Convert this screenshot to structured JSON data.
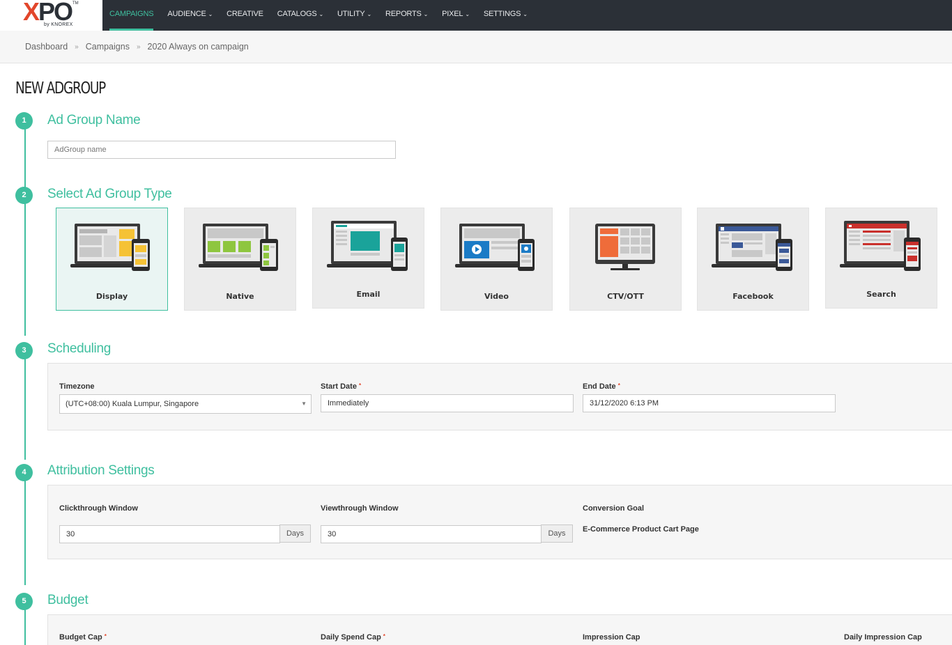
{
  "logo": {
    "mark_x": "X",
    "mark_rest": "PO",
    "tm": "TM",
    "sub": "by KNOREX"
  },
  "nav": [
    {
      "label": "CAMPAIGNS",
      "caret": false,
      "active": true
    },
    {
      "label": "AUDIENCE",
      "caret": true
    },
    {
      "label": "CREATIVE",
      "caret": false
    },
    {
      "label": "CATALOGS",
      "caret": true
    },
    {
      "label": "UTILITY",
      "caret": true
    },
    {
      "label": "REPORTS",
      "caret": true
    },
    {
      "label": "PIXEL",
      "caret": true
    },
    {
      "label": "SETTINGS",
      "caret": true
    }
  ],
  "breadcrumb": {
    "items": [
      "Dashboard",
      "Campaigns",
      "2020 Always on campaign"
    ],
    "separator": "»"
  },
  "page_title": "NEW ADGROUP",
  "steps": {
    "s1": {
      "number": "1",
      "title": "Ad Group Name",
      "placeholder": "AdGroup name"
    },
    "s2": {
      "number": "2",
      "title": "Select Ad Group Type"
    },
    "s3": {
      "number": "3",
      "title": "Scheduling"
    },
    "s4": {
      "number": "4",
      "title": "Attribution Settings"
    },
    "s5": {
      "number": "5",
      "title": "Budget"
    }
  },
  "ad_types": [
    {
      "label": "Display",
      "icon": "display-icon",
      "selected": true
    },
    {
      "label": "Native",
      "icon": "native-icon"
    },
    {
      "label": "Email",
      "icon": "email-icon"
    },
    {
      "label": "Video",
      "icon": "video-icon"
    },
    {
      "label": "CTV/OTT",
      "icon": "ctv-ott-icon"
    },
    {
      "label": "Facebook",
      "icon": "facebook-icon"
    },
    {
      "label": "Search",
      "icon": "search-ad-icon"
    }
  ],
  "scheduling": {
    "timezone_label": "Timezone",
    "timezone_value": "(UTC+08:00) Kuala Lumpur, Singapore",
    "start_label": "Start Date",
    "start_value": "Immediately",
    "end_label": "End Date",
    "end_value": "31/12/2020 6:13 PM",
    "required_mark": "*"
  },
  "attribution": {
    "click_label": "Clickthrough Window",
    "click_value": "30",
    "view_label": "Viewthrough Window",
    "view_value": "30",
    "days": "Days",
    "goal_label": "Conversion Goal",
    "goal_value": "E-Commerce Product Cart Page"
  },
  "budget": {
    "budget_cap": "Budget Cap",
    "daily_spend_cap": "Daily Spend Cap",
    "impression_cap": "Impression Cap",
    "daily_impression_cap": "Daily Impression Cap"
  },
  "colors": {
    "accent": "#3fbf9f",
    "nav_bg": "#2b3037",
    "logo_red": "#e2462b",
    "required": "#e2462b"
  }
}
